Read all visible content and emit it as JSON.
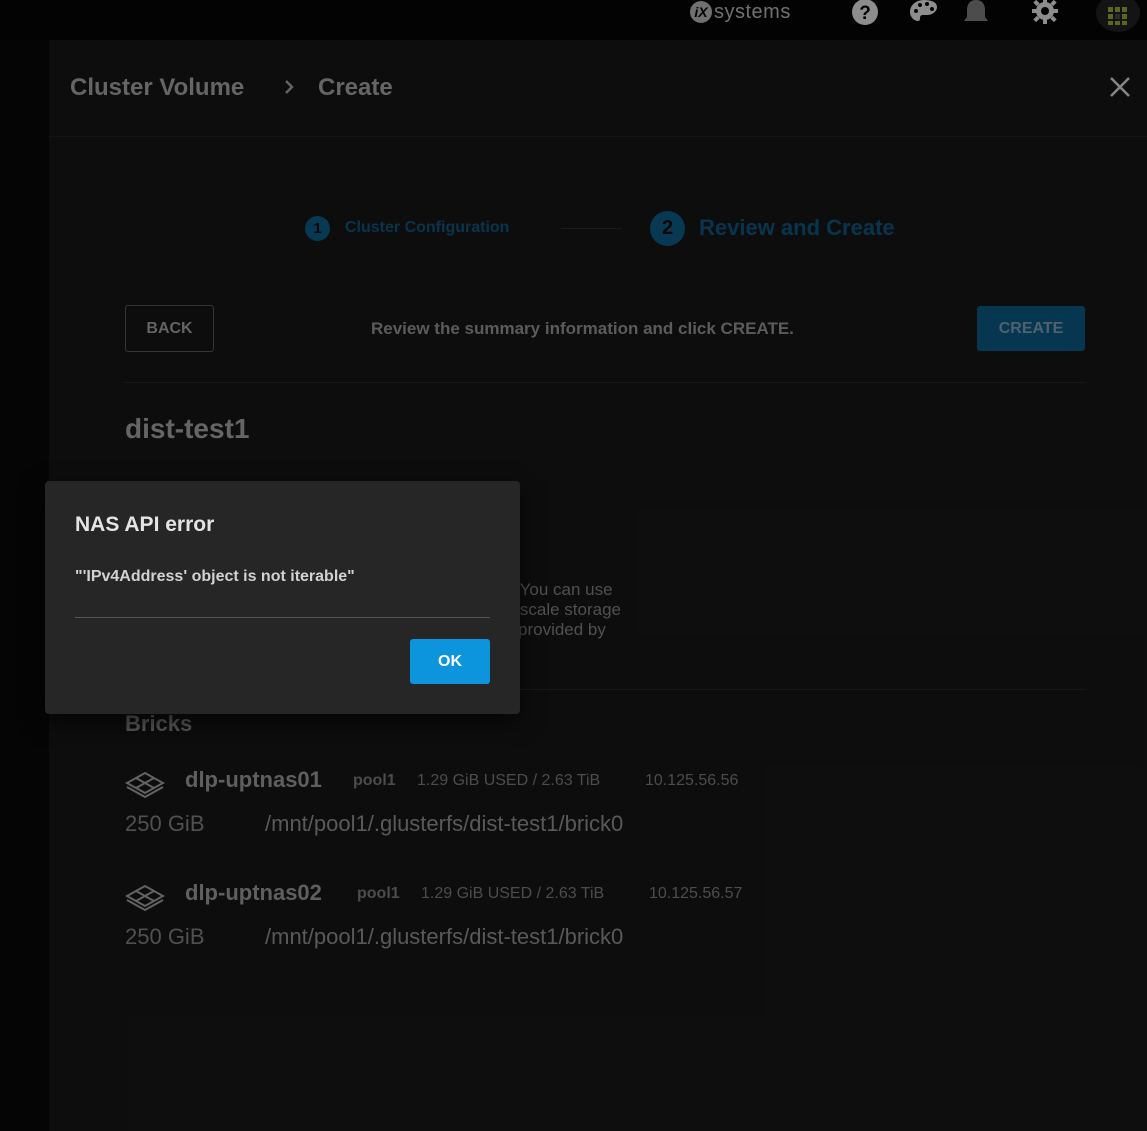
{
  "topbar": {
    "brand_mark": "iX",
    "brand_text": "systems",
    "icons": [
      "help-icon",
      "palette-icon",
      "bell-icon",
      "gear-icon",
      "apps-grid-icon"
    ]
  },
  "header": {
    "breadcrumb": [
      "Cluster Volume",
      "Create"
    ]
  },
  "stepper": {
    "steps": [
      {
        "number": "1",
        "label": "Cluster Configuration"
      },
      {
        "number": "2",
        "label": "Review and Create"
      }
    ]
  },
  "actions": {
    "back_label": "BACK",
    "review_text": "Review the summary information and click CREATE.",
    "create_label": "CREATE"
  },
  "volume": {
    "name": "dist-test1",
    "description_fragments": [
      "e. You can use",
      "to scale storage",
      "is provided by"
    ]
  },
  "bricks": {
    "title": "Bricks",
    "items": [
      {
        "host": "dlp-uptnas01",
        "pool": "pool1",
        "usage": "1.29 GiB USED / 2.63 TiB",
        "ip": "10.125.56.56",
        "size": "250 GiB",
        "path": "/mnt/pool1/.glusterfs/dist-test1/brick0"
      },
      {
        "host": "dlp-uptnas02",
        "pool": "pool1",
        "usage": "1.29 GiB USED / 2.63 TiB",
        "ip": "10.125.56.57",
        "size": "250 GiB",
        "path": "/mnt/pool1/.glusterfs/dist-test1/brick0"
      }
    ]
  },
  "dialog": {
    "title": "NAS API error",
    "message": "\"'IPv4Address' object is not iterable\"",
    "ok_label": "OK"
  },
  "colors": {
    "accent": "#0c95dd",
    "background": "#131313",
    "dialog_bg": "#262626"
  }
}
